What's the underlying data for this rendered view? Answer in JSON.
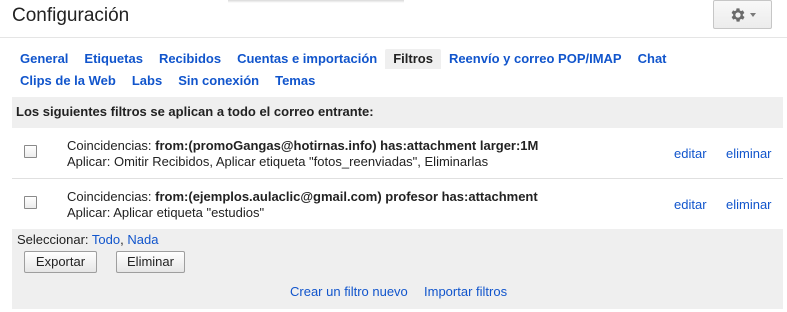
{
  "header": {
    "title": "Configuración",
    "settings_icon": "gear-icon",
    "dropdown_icon": "chevron-down-icon"
  },
  "tabs": [
    {
      "label": "General",
      "active": false
    },
    {
      "label": "Etiquetas",
      "active": false
    },
    {
      "label": "Recibidos",
      "active": false
    },
    {
      "label": "Cuentas e importación",
      "active": false
    },
    {
      "label": "Filtros",
      "active": true
    },
    {
      "label": "Reenvío y correo POP/IMAP",
      "active": false
    },
    {
      "label": "Chat",
      "active": false
    },
    {
      "label": "Clips de la Web",
      "active": false
    },
    {
      "label": "Labs",
      "active": false
    },
    {
      "label": "Sin conexión",
      "active": false
    },
    {
      "label": "Temas",
      "active": false
    }
  ],
  "filters_panel": {
    "heading": "Los siguientes filtros se aplican a todo el correo entrante:",
    "filters": [
      {
        "match_prefix": "Coincidencias: ",
        "criteria": "from:(promoGangas@hotirnas.info) has:attachment larger:1M",
        "action": "Aplicar: Omitir Recibidos, Aplicar etiqueta \"fotos_reenviadas\", Eliminarlas",
        "edit_label": "editar",
        "delete_label": "eliminar"
      },
      {
        "match_prefix": "Coincidencias: ",
        "criteria": "from:(ejemplos.aulaclic@gmail.com) profesor has:attachment",
        "action": "Aplicar: Aplicar etiqueta \"estudios\"",
        "edit_label": "editar",
        "delete_label": "eliminar"
      }
    ],
    "select_label": "Seleccionar: ",
    "select_all": "Todo",
    "select_sep": ", ",
    "select_none": "Nada",
    "export_button": "Exportar",
    "delete_button": "Eliminar",
    "create_filter_link": "Crear un filtro nuevo",
    "import_filters_link": "Importar filtros"
  },
  "colors": {
    "link": "#1155cc",
    "panel_bg": "#efefef",
    "text": "#222222"
  }
}
